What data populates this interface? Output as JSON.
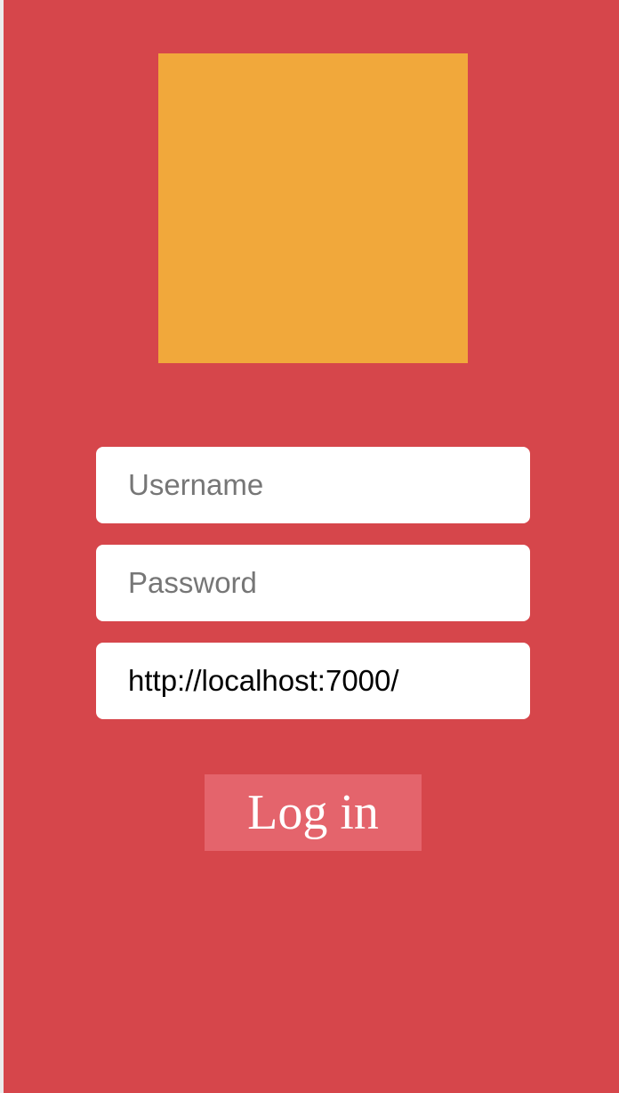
{
  "login": {
    "username_placeholder": "Username",
    "password_placeholder": "Password",
    "server_value": "http://localhost:7000/",
    "login_label": "Log in"
  },
  "colors": {
    "background": "#d6464b",
    "logo": "#f1a83b",
    "button": "#e4646c"
  }
}
